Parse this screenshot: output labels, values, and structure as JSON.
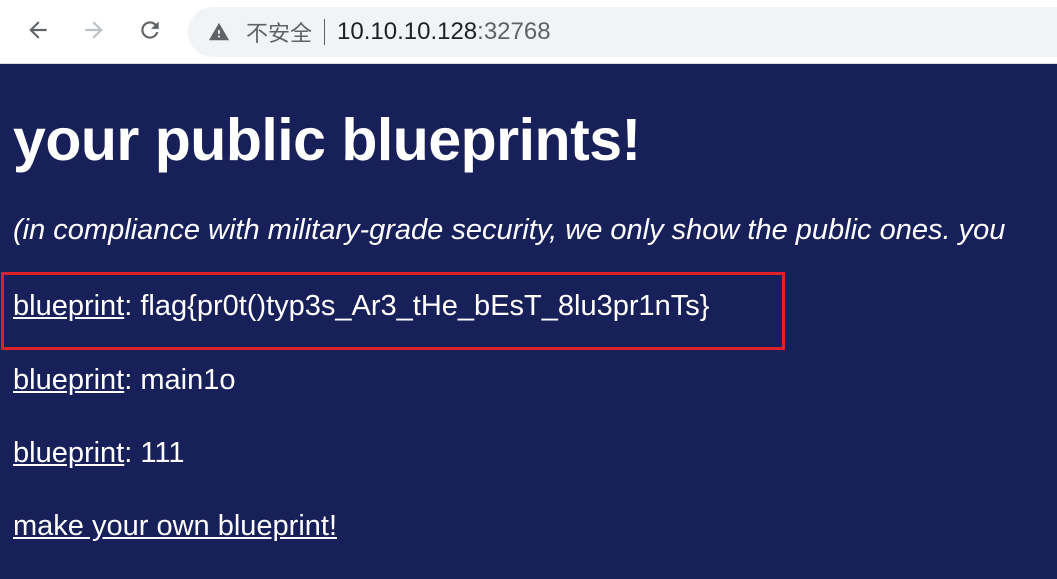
{
  "browser": {
    "security_label": "不安全",
    "url_host": "10.10.10.128",
    "url_port": ":32768"
  },
  "page": {
    "heading": "your public blueprints!",
    "note": "(in compliance with military-grade security, we only show the public ones. you",
    "separator": ": ",
    "blueprints": [
      {
        "link": "blueprint",
        "name": "flag{pr0t()typ3s_Ar3_tHe_bEsT_8lu3pr1nTs}"
      },
      {
        "link": "blueprint",
        "name": "main1o"
      },
      {
        "link": "blueprint",
        "name": "111"
      }
    ],
    "make_link": "make your own blueprint!"
  },
  "colors": {
    "page_background": "#18205a",
    "highlight_border": "#e0202a"
  }
}
